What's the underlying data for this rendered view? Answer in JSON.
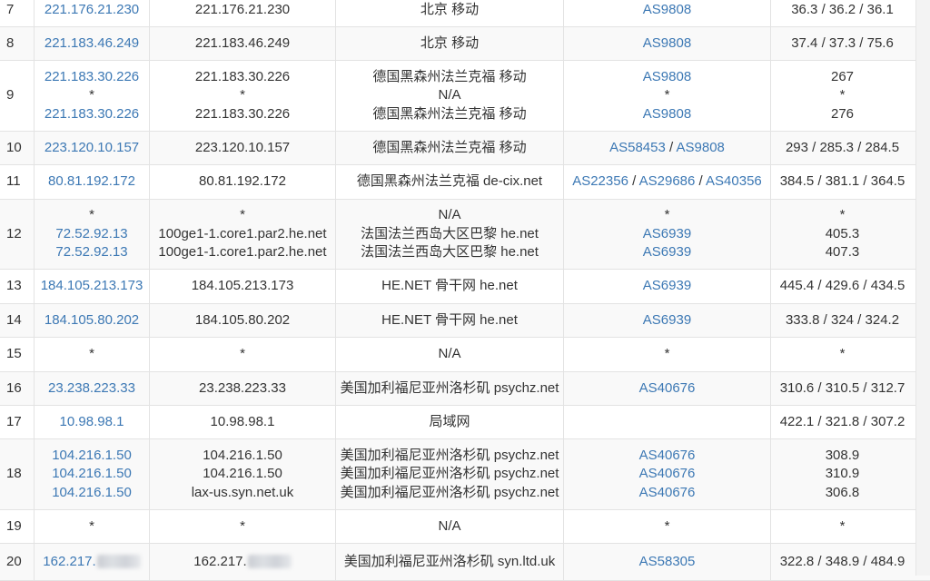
{
  "rows": [
    {
      "hop": "7",
      "ip": [
        "221.176.21.230"
      ],
      "host": [
        "221.176.21.230"
      ],
      "loc": [
        "北京 移动"
      ],
      "as": [
        [
          "AS9808"
        ]
      ],
      "time": [
        "36.3 / 36.2 / 36.1"
      ]
    },
    {
      "hop": "8",
      "ip": [
        "221.183.46.249"
      ],
      "host": [
        "221.183.46.249"
      ],
      "loc": [
        "北京 移动"
      ],
      "as": [
        [
          "AS9808"
        ]
      ],
      "time": [
        "37.4 / 37.3 / 75.6"
      ]
    },
    {
      "hop": "9",
      "ip": [
        "221.183.30.226",
        "*",
        "221.183.30.226"
      ],
      "host": [
        "221.183.30.226",
        "*",
        "221.183.30.226"
      ],
      "loc": [
        "德国黑森州法兰克福 移动",
        "N/A",
        "德国黑森州法兰克福 移动"
      ],
      "as": [
        [
          "AS9808"
        ],
        [
          "*"
        ],
        [
          "AS9808"
        ]
      ],
      "time": [
        "267",
        "*",
        "276"
      ]
    },
    {
      "hop": "10",
      "ip": [
        "223.120.10.157"
      ],
      "host": [
        "223.120.10.157"
      ],
      "loc": [
        "德国黑森州法兰克福 移动"
      ],
      "as": [
        [
          "AS58453",
          "AS9808"
        ]
      ],
      "time": [
        "293 / 285.3 / 284.5"
      ]
    },
    {
      "hop": "11",
      "ip": [
        "80.81.192.172"
      ],
      "host": [
        "80.81.192.172"
      ],
      "loc": [
        "德国黑森州法兰克福 de-cix.net"
      ],
      "as": [
        [
          "AS22356",
          "AS29686",
          "AS40356"
        ]
      ],
      "time": [
        "384.5 / 381.1 / 364.5"
      ]
    },
    {
      "hop": "12",
      "ip": [
        "*",
        "72.52.92.13",
        "72.52.92.13"
      ],
      "host": [
        "*",
        "100ge1-1.core1.par2.he.net",
        "100ge1-1.core1.par2.he.net"
      ],
      "loc": [
        "N/A",
        "法国法兰西岛大区巴黎 he.net",
        "法国法兰西岛大区巴黎 he.net"
      ],
      "as": [
        [
          "*"
        ],
        [
          "AS6939"
        ],
        [
          "AS6939"
        ]
      ],
      "time": [
        "*",
        "405.3",
        "407.3"
      ]
    },
    {
      "hop": "13",
      "ip": [
        "184.105.213.173"
      ],
      "host": [
        "184.105.213.173"
      ],
      "loc": [
        "HE.NET 骨干网 he.net"
      ],
      "as": [
        [
          "AS6939"
        ]
      ],
      "time": [
        "445.4 / 429.6 / 434.5"
      ]
    },
    {
      "hop": "14",
      "ip": [
        "184.105.80.202"
      ],
      "host": [
        "184.105.80.202"
      ],
      "loc": [
        "HE.NET 骨干网 he.net"
      ],
      "as": [
        [
          "AS6939"
        ]
      ],
      "time": [
        "333.8 / 324 / 324.2"
      ]
    },
    {
      "hop": "15",
      "ip": [
        "*"
      ],
      "host": [
        "*"
      ],
      "loc": [
        "N/A"
      ],
      "as": [
        [
          "*"
        ]
      ],
      "time": [
        "*"
      ]
    },
    {
      "hop": "16",
      "ip": [
        "23.238.223.33"
      ],
      "host": [
        "23.238.223.33"
      ],
      "loc": [
        "美国加利福尼亚州洛杉矶 psychz.net"
      ],
      "as": [
        [
          "AS40676"
        ]
      ],
      "time": [
        "310.6 / 310.5 / 312.7"
      ]
    },
    {
      "hop": "17",
      "ip": [
        "10.98.98.1"
      ],
      "host": [
        "10.98.98.1"
      ],
      "loc": [
        "局域网"
      ],
      "as": [
        []
      ],
      "time": [
        "422.1 / 321.8 / 307.2"
      ]
    },
    {
      "hop": "18",
      "ip": [
        "104.216.1.50",
        "104.216.1.50",
        "104.216.1.50"
      ],
      "host": [
        "104.216.1.50",
        "104.216.1.50",
        "lax-us.syn.net.uk"
      ],
      "loc": [
        "美国加利福尼亚州洛杉矶 psychz.net",
        "美国加利福尼亚州洛杉矶 psychz.net",
        "美国加利福尼亚州洛杉矶 psychz.net"
      ],
      "as": [
        [
          "AS40676"
        ],
        [
          "AS40676"
        ],
        [
          "AS40676"
        ]
      ],
      "time": [
        "308.9",
        "310.9",
        "306.8"
      ]
    },
    {
      "hop": "19",
      "ip": [
        "*"
      ],
      "host": [
        "*"
      ],
      "loc": [
        "N/A"
      ],
      "as": [
        [
          "*"
        ]
      ],
      "time": [
        "*"
      ]
    },
    {
      "hop": "20",
      "ip": [
        "162.217."
      ],
      "host": [
        "162.217."
      ],
      "loc": [
        "美国加利福尼亚州洛杉矶 syn.ltd.uk"
      ],
      "as": [
        [
          "AS58305"
        ]
      ],
      "time": [
        "322.8 / 348.9 / 484.9"
      ],
      "redacted": true
    }
  ]
}
